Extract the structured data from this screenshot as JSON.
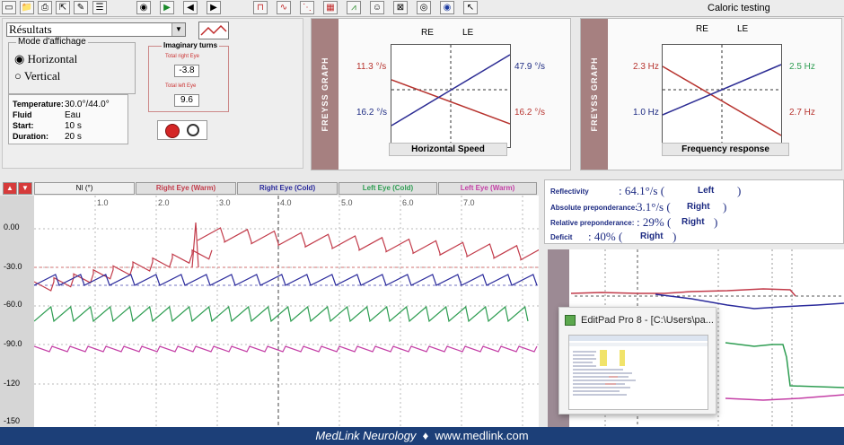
{
  "window": {
    "title": "Caloric testing"
  },
  "toolbar": {
    "icons": [
      "new-icon",
      "open-icon",
      "print-icon",
      "export-icon",
      "notes-icon",
      "record-icon",
      "play-icon",
      "back-icon",
      "forward-icon",
      "square-wave-icon",
      "sine-wave-icon",
      "target-icon",
      "grid-icon",
      "trend-icon",
      "person-icon",
      "close-box-icon",
      "eye-icon",
      "eye-target-icon",
      "cursor-icon"
    ]
  },
  "control_panel": {
    "results_select": "Résultats",
    "mode_title": "Mode d'affichage",
    "mode_options": [
      "Horizontal",
      "Vertical"
    ],
    "imaginary_turns_title": "Imaginary turns",
    "total_right_label": "Total right Eye",
    "total_right_value": "-3.8",
    "total_left_label": "Total left Eye",
    "total_left_value": "9.6",
    "info": {
      "temperature_label": "Temperature:",
      "temperature_value": "30.0°/44.0°",
      "fluid_label": "Fluid",
      "fluid_value": "Eau",
      "start_label": "Start:",
      "start_value": "10 s",
      "duration_label": "Duration:",
      "duration_value": "20 s"
    }
  },
  "freyss_speed": {
    "side_label": "FREYSS GRAPH",
    "re": "RE",
    "le": "LE",
    "left_top": "11.3 °/s",
    "left_bottom": "16.2 °/s",
    "right_top": "47.9 °/s",
    "right_bottom": "16.2 °/s",
    "title": "Horizontal Speed"
  },
  "freyss_freq": {
    "side_label": "FREYSS GRAPH",
    "re": "RE",
    "le": "LE",
    "left_top": "2.3 Hz",
    "left_bottom": "1.0 Hz",
    "right_top": "2.5 Hz",
    "right_bottom": "2.7 Hz",
    "title": "Frequency response"
  },
  "channels": {
    "ni": "NI (°)",
    "right_warm": "Right Eye (Warm)",
    "right_cold": "Right Eye (Cold)",
    "left_cold": "Left Eye (Cold)",
    "left_warm": "Left Eye (Warm)"
  },
  "wave": {
    "x_ticks": [
      "1.0",
      "2.0",
      "3.0",
      "4.0",
      "5.0",
      "6.0",
      "7.0"
    ],
    "y_ticks": [
      "0.00",
      "-30.0",
      "-60.0",
      "-90.0",
      "-120",
      "-150"
    ],
    "colors": {
      "red": "#c23b4a",
      "blue": "#2b2b9c",
      "green": "#2e9d52",
      "pink": "#c43fa6"
    }
  },
  "results": {
    "reflectivity_label": "Reflectivity",
    "reflectivity_value": ": 64.1°/s (",
    "reflectivity_side": "Left",
    "absolute_label": "Absolute preponderance:",
    "absolute_value": "3.1°/s (",
    "absolute_side": "Right",
    "relative_label": "Relative preponderance:",
    "relative_value": ": 29% (",
    "relative_side": "Right",
    "deficit_label": "Deficit",
    "deficit_value": ": 40% (",
    "deficit_side": "Right"
  },
  "editpad": {
    "title": "EditPad Pro 8 - [C:\\Users\\pa..."
  },
  "footer": {
    "brand": "MedLink Neurology",
    "separator": "♦",
    "url": "www.medlink.com"
  }
}
